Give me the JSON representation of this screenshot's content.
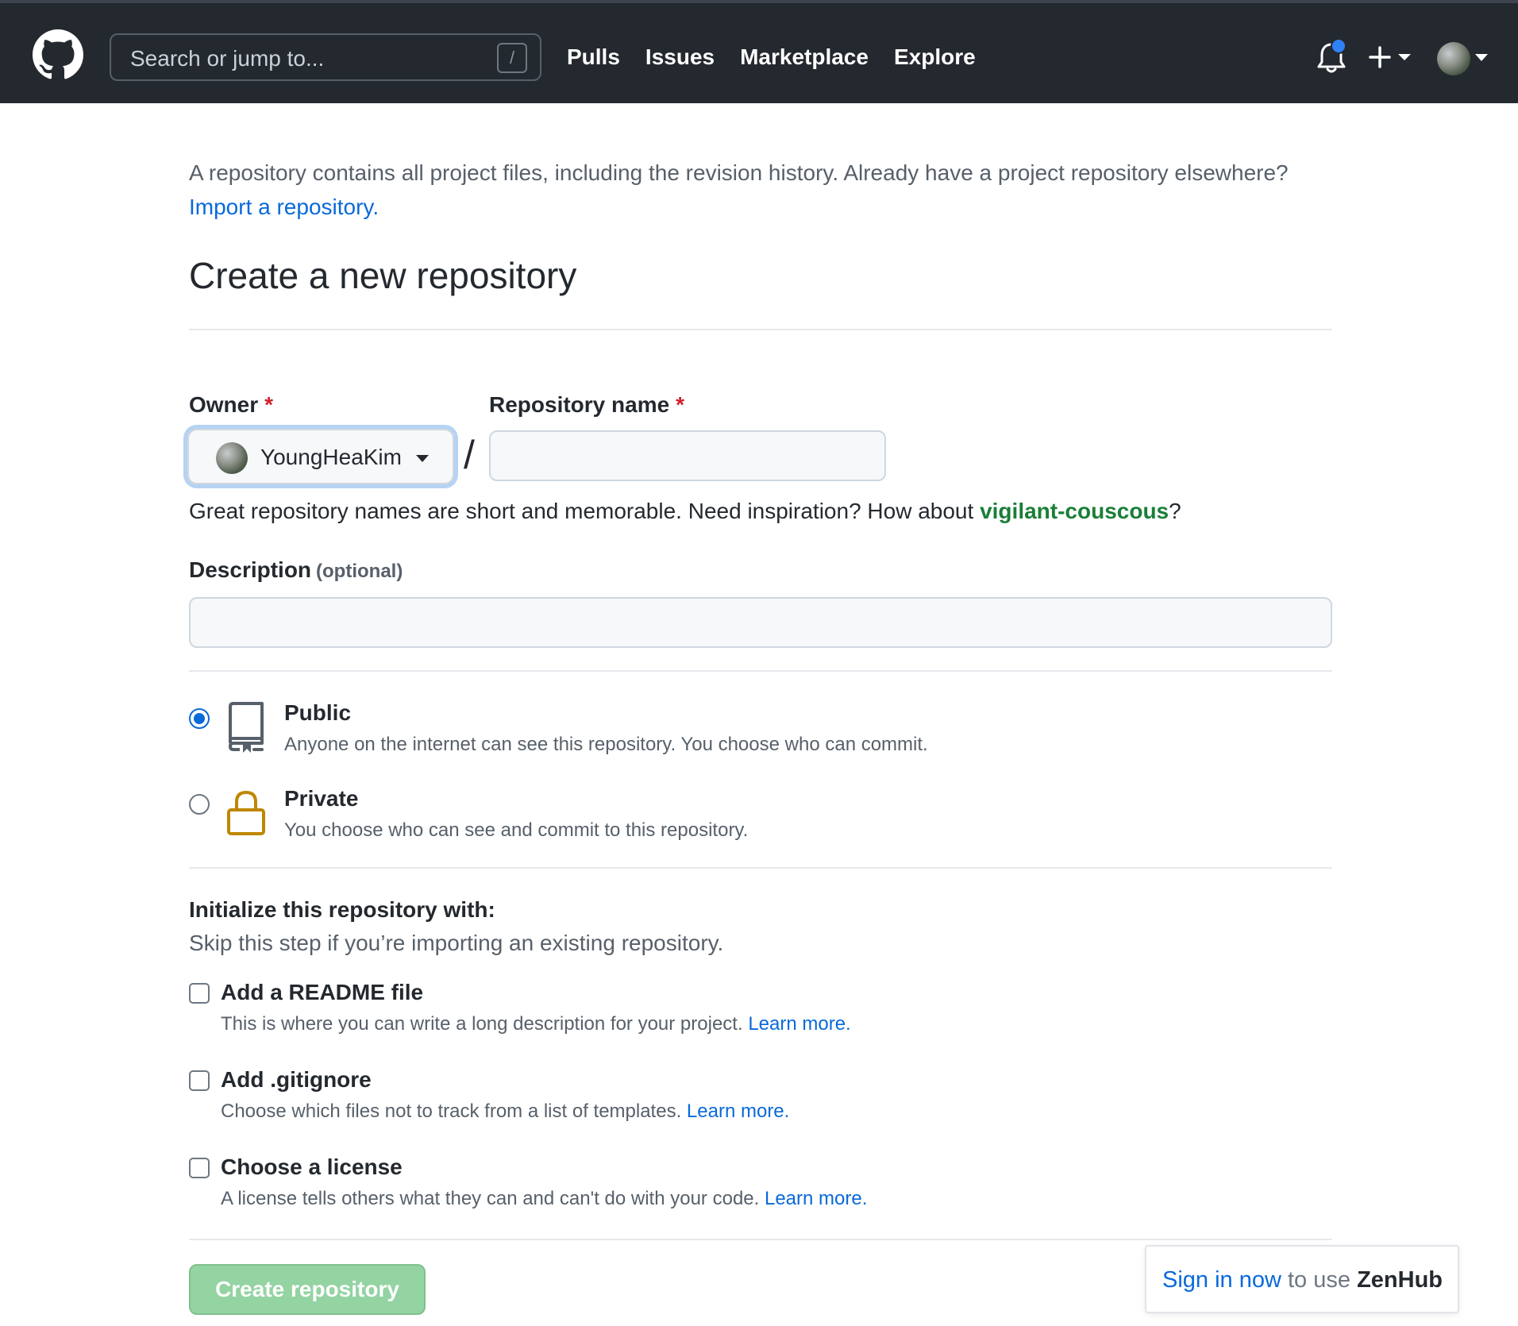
{
  "header": {
    "search_placeholder": "Search or jump to...",
    "search_shortcut": "/",
    "nav": [
      "Pulls",
      "Issues",
      "Marketplace",
      "Explore"
    ],
    "notification_dot_color": "#2f81f7"
  },
  "intro": {
    "text": "A repository contains all project files, including the revision history. Already have a project repository elsewhere?",
    "import_link": "Import a repository."
  },
  "page_title": "Create a new repository",
  "form": {
    "owner_label": "Owner",
    "required_mark": "*",
    "owner_value": "YoungHeaKim",
    "separator": "/",
    "repo_name_label": "Repository name",
    "repo_name_value": "",
    "hint_prefix": "Great repository names are short and memorable. Need inspiration? How about",
    "hint_suggestion": "vigilant-couscous",
    "hint_suffix": "?",
    "description_label": "Description",
    "description_optional": "(optional)",
    "description_value": ""
  },
  "visibility": {
    "selected": "public",
    "public_title": "Public",
    "public_desc": "Anyone on the internet can see this repository. You choose who can commit.",
    "private_title": "Private",
    "private_desc": "You choose who can see and commit to this repository."
  },
  "initialize": {
    "title": "Initialize this repository with:",
    "subtitle": "Skip this step if you’re importing an existing repository.",
    "options": [
      {
        "title": "Add a README file",
        "desc": "This is where you can write a long description for your project.",
        "link": "Learn more.",
        "checked": false
      },
      {
        "title": "Add .gitignore",
        "desc": "Choose which files not to track from a list of templates.",
        "link": "Learn more.",
        "checked": false
      },
      {
        "title": "Choose a license",
        "desc": "A license tells others what they can and can't do with your code.",
        "link": "Learn more.",
        "checked": false
      }
    ]
  },
  "submit_label": "Create repository",
  "zenhub": {
    "link": "Sign in now",
    "middle": "to use",
    "brand": "ZenHub"
  }
}
